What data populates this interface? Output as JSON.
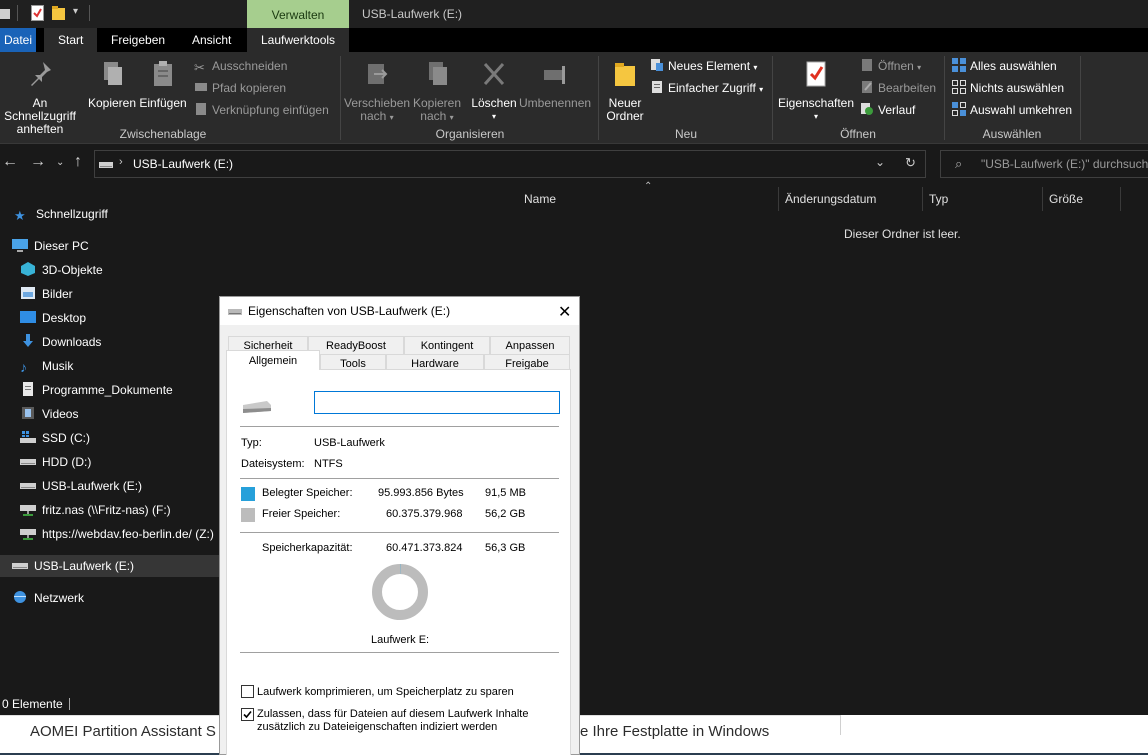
{
  "titlebar": {
    "context_tab": "Verwalten",
    "window_title": "USB-Laufwerk (E:)"
  },
  "tabs": {
    "file": "Datei",
    "start": "Start",
    "share": "Freigeben",
    "view": "Ansicht",
    "drive_tools": "Laufwerktools"
  },
  "ribbon": {
    "pin_line1": "An Schnellzugriff",
    "pin_line2": "anheften",
    "copy": "Kopieren",
    "paste": "Einfügen",
    "cut": "Ausschneiden",
    "copy_path": "Pfad kopieren",
    "paste_shortcut": "Verknüpfung einfügen",
    "group_clipboard": "Zwischenablage",
    "move_line1": "Verschieben",
    "move_line2": "nach",
    "copyto_line1": "Kopieren",
    "copyto_line2": "nach",
    "delete": "Löschen",
    "rename": "Umbenennen",
    "group_organize": "Organisieren",
    "new_folder_line1": "Neuer",
    "new_folder_line2": "Ordner",
    "new_item": "Neues Element",
    "easy_access": "Einfacher Zugriff",
    "group_new": "Neu",
    "properties": "Eigenschaften",
    "open": "Öffnen",
    "edit": "Bearbeiten",
    "history": "Verlauf",
    "group_open": "Öffnen",
    "select_all": "Alles auswählen",
    "select_none": "Nichts auswählen",
    "invert_selection": "Auswahl umkehren",
    "group_select": "Auswählen"
  },
  "navbar": {
    "path": "USB-Laufwerk (E:)",
    "search_placeholder": "\"USB-Laufwerk (E:)\" durchsuchen"
  },
  "sidebar": {
    "items": [
      {
        "label": "Schnellzugriff"
      },
      {
        "label": "Dieser PC"
      },
      {
        "label": "3D-Objekte"
      },
      {
        "label": "Bilder"
      },
      {
        "label": "Desktop"
      },
      {
        "label": "Downloads"
      },
      {
        "label": "Musik"
      },
      {
        "label": "Programme_Dokumente"
      },
      {
        "label": "Videos"
      },
      {
        "label": "SSD (C:)"
      },
      {
        "label": "HDD (D:)"
      },
      {
        "label": "USB-Laufwerk (E:)"
      },
      {
        "label": "fritz.nas (\\\\Fritz-nas) (F:)"
      },
      {
        "label": "https://webdav.feo-berlin.de/ (Z:)"
      },
      {
        "label": "USB-Laufwerk (E:)"
      },
      {
        "label": "Netzwerk"
      }
    ]
  },
  "content": {
    "columns": [
      "Name",
      "Änderungsdatum",
      "Typ",
      "Größe"
    ],
    "empty_message": "Dieser Ordner ist leer."
  },
  "status": {
    "items_count": "0 Elemente"
  },
  "background_page": {
    "text_left": "AOMEI Partition Assistant S",
    "text_right": "e Ihre Festplatte in Windows"
  },
  "dialog": {
    "title": "Eigenschaften von USB-Laufwerk (E:)",
    "tabs_row1": [
      "Sicherheit",
      "ReadyBoost",
      "Kontingent",
      "Anpassen"
    ],
    "tabs_row2": [
      "Allgemein",
      "Tools",
      "Hardware",
      "Freigabe"
    ],
    "name_value": "",
    "type_label": "Typ:",
    "type_value": "USB-Laufwerk",
    "fs_label": "Dateisystem:",
    "fs_value": "NTFS",
    "used_label": "Belegter Speicher:",
    "used_bytes": "95.993.856 Bytes",
    "used_size": "91,5 MB",
    "free_label": "Freier Speicher:",
    "free_bytes": "60.375.379.968",
    "free_size": "56,2 GB",
    "capacity_label": "Speicherkapazität:",
    "capacity_bytes": "60.471.373.824",
    "capacity_size": "56,3 GB",
    "used_fraction": 0.0016,
    "used_color": "#26a0da",
    "free_color": "#bcbcbc",
    "drive_label": "Laufwerk E:",
    "compress_label": "Laufwerk komprimieren, um Speicherplatz zu sparen",
    "compress_checked": false,
    "index_label_line1": "Zulassen, dass für Dateien auf diesem Laufwerk Inhalte",
    "index_label_line2": "zusätzlich zu Dateieigenschaften indiziert werden",
    "index_checked": true
  }
}
